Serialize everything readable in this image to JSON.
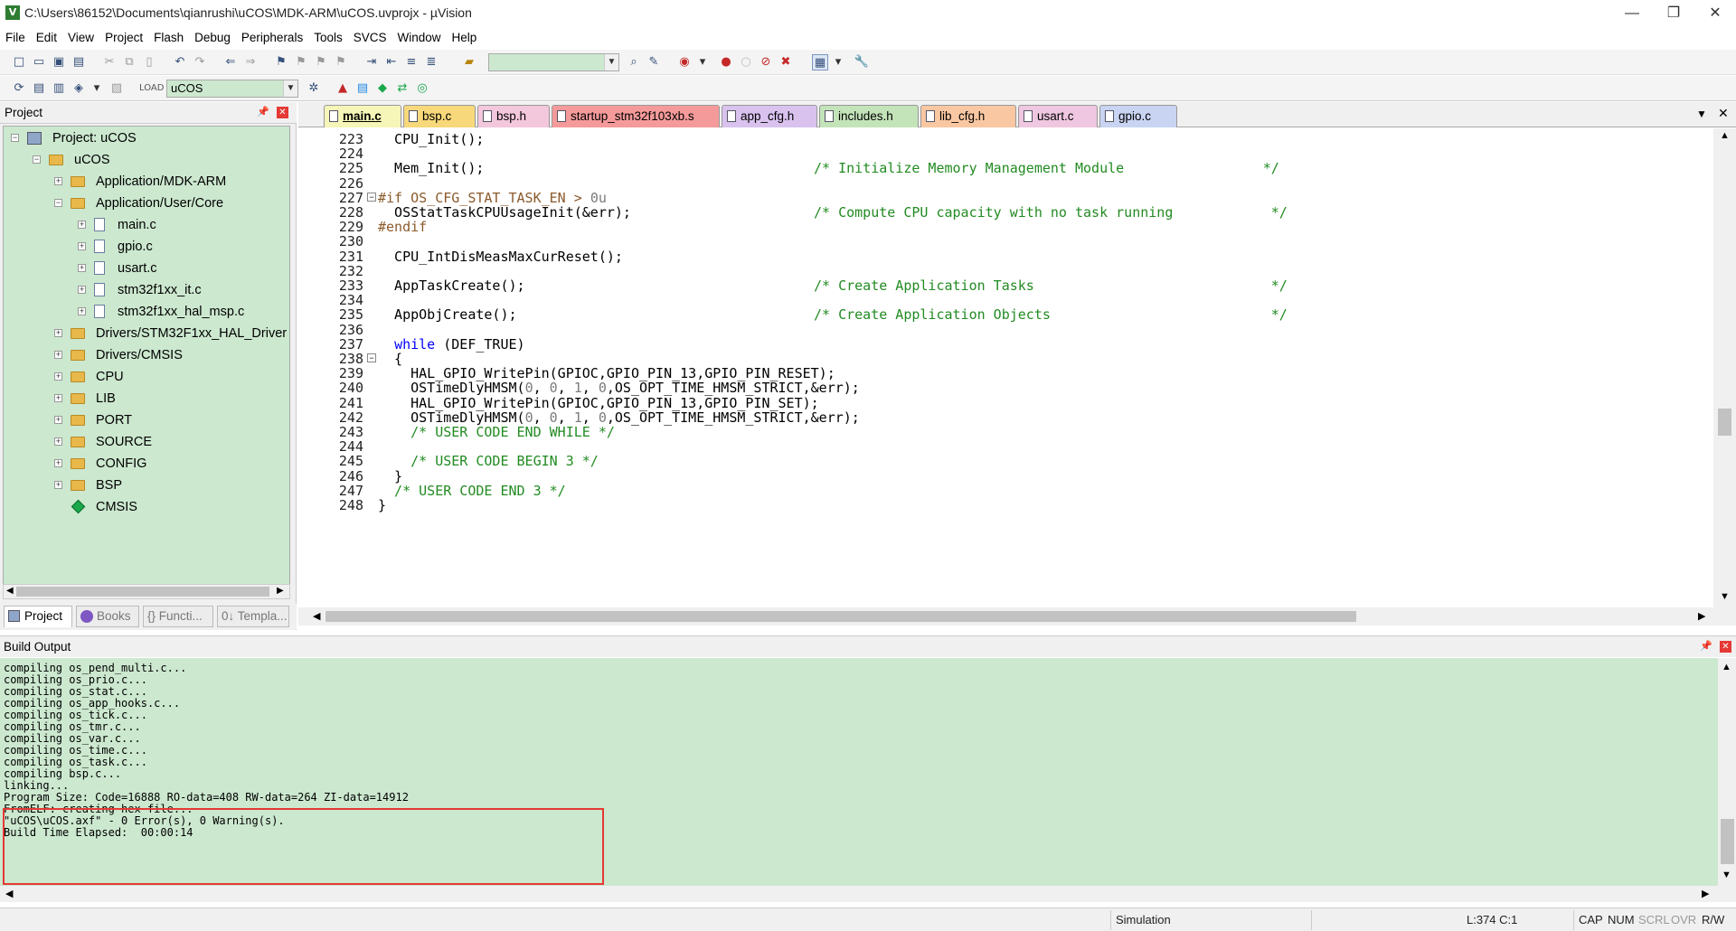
{
  "window": {
    "title": "C:\\Users\\86152\\Documents\\qianrushi\\uCOS\\MDK-ARM\\uCOS.uvprojx - µVision",
    "minimize": "—",
    "restore": "❐",
    "close": "✕"
  },
  "menu": [
    "File",
    "Edit",
    "View",
    "Project",
    "Flash",
    "Debug",
    "Peripherals",
    "Tools",
    "SVCS",
    "Window",
    "Help"
  ],
  "toolbar": {
    "target_name": "uCOS",
    "find_value": ""
  },
  "project_panel": {
    "title": "Project",
    "tree": [
      {
        "label": "Project: uCOS"
      },
      {
        "label": "uCOS"
      },
      {
        "label": "Application/MDK-ARM"
      },
      {
        "label": "Application/User/Core"
      },
      {
        "label": "main.c"
      },
      {
        "label": "gpio.c"
      },
      {
        "label": "usart.c"
      },
      {
        "label": "stm32f1xx_it.c"
      },
      {
        "label": "stm32f1xx_hal_msp.c"
      },
      {
        "label": "Drivers/STM32F1xx_HAL_Driver"
      },
      {
        "label": "Drivers/CMSIS"
      },
      {
        "label": "CPU"
      },
      {
        "label": "LIB"
      },
      {
        "label": "PORT"
      },
      {
        "label": "SOURCE"
      },
      {
        "label": "CONFIG"
      },
      {
        "label": "BSP"
      },
      {
        "label": "CMSIS"
      }
    ],
    "tabs": [
      "Project",
      "Books",
      "{} Functi...",
      "0↓ Templa..."
    ]
  },
  "editor": {
    "tabs": [
      {
        "label": "main.c",
        "color": "#f6f6b8"
      },
      {
        "label": "bsp.c",
        "color": "#f7d87a"
      },
      {
        "label": "bsp.h",
        "color": "#f3c7dc"
      },
      {
        "label": "startup_stm32f103xb.s",
        "color": "#f59a9a"
      },
      {
        "label": "app_cfg.h",
        "color": "#d9c2ee"
      },
      {
        "label": "includes.h",
        "color": "#c3e3b9"
      },
      {
        "label": "lib_cfg.h",
        "color": "#f9c7a2"
      },
      {
        "label": "usart.c",
        "color": "#efc7e0"
      },
      {
        "label": "gpio.c",
        "color": "#c9d4f2"
      }
    ],
    "lines": [
      {
        "n": "223",
        "code": "  CPU_Init();",
        "comment": ""
      },
      {
        "n": "224",
        "code": "",
        "comment": ""
      },
      {
        "n": "225",
        "code": "  Mem_Init();",
        "comment": "/* Initialize Memory Management Module                 */"
      },
      {
        "n": "226",
        "code": "",
        "comment": ""
      },
      {
        "n": "227",
        "code": "#if OS_CFG_STAT_TASK_EN > 0u",
        "comment": ""
      },
      {
        "n": "228",
        "code": "  OSStatTaskCPUUsageInit(&err);",
        "comment": "/* Compute CPU capacity with no task running            */"
      },
      {
        "n": "229",
        "code": "#endif",
        "comment": ""
      },
      {
        "n": "230",
        "code": "",
        "comment": ""
      },
      {
        "n": "231",
        "code": "  CPU_IntDisMeasMaxCurReset();",
        "comment": ""
      },
      {
        "n": "232",
        "code": "",
        "comment": ""
      },
      {
        "n": "233",
        "code": "  AppTaskCreate();",
        "comment": "/* Create Application Tasks                             */"
      },
      {
        "n": "234",
        "code": "",
        "comment": ""
      },
      {
        "n": "235",
        "code": "  AppObjCreate();",
        "comment": "/* Create Application Objects                           */"
      },
      {
        "n": "236",
        "code": "",
        "comment": ""
      },
      {
        "n": "237",
        "code": "  while (DEF_TRUE)",
        "comment": ""
      },
      {
        "n": "238",
        "code": "  {",
        "comment": ""
      },
      {
        "n": "239",
        "code": "    HAL_GPIO_WritePin(GPIOC,GPIO_PIN_13,GPIO_PIN_RESET);",
        "comment": ""
      },
      {
        "n": "240",
        "code": "    OSTimeDlyHMSM(0, 0, 1, 0,OS_OPT_TIME_HMSM_STRICT,&err);",
        "comment": ""
      },
      {
        "n": "241",
        "code": "    HAL_GPIO_WritePin(GPIOC,GPIO_PIN_13,GPIO_PIN_SET);",
        "comment": ""
      },
      {
        "n": "242",
        "code": "    OSTimeDlyHMSM(0, 0, 1, 0,OS_OPT_TIME_HMSM_STRICT,&err);",
        "comment": ""
      },
      {
        "n": "243",
        "code": "    /* USER CODE END WHILE */",
        "comment": ""
      },
      {
        "n": "244",
        "code": "",
        "comment": ""
      },
      {
        "n": "245",
        "code": "    /* USER CODE BEGIN 3 */",
        "comment": ""
      },
      {
        "n": "246",
        "code": "  }",
        "comment": ""
      },
      {
        "n": "247",
        "code": "  /* USER CODE END 3 */",
        "comment": ""
      },
      {
        "n": "248",
        "code": "}",
        "comment": ""
      }
    ]
  },
  "build_output": {
    "title": "Build Output",
    "lines": [
      "compiling os_pend_multi.c...",
      "compiling os_prio.c...",
      "compiling os_stat.c...",
      "compiling os_app_hooks.c...",
      "compiling os_tick.c...",
      "compiling os_tmr.c...",
      "compiling os_var.c...",
      "compiling os_time.c...",
      "compiling os_task.c...",
      "compiling bsp.c...",
      "linking...",
      "Program Size: Code=16888 RO-data=408 RW-data=264 ZI-data=14912",
      "FromELF: creating hex file...",
      "\"uCOS\\uCOS.axf\" - 0 Error(s), 0 Warning(s).",
      "Build Time Elapsed:  00:00:14"
    ],
    "highlight_color": "#e53935"
  },
  "statusbar": {
    "mode": "Simulation",
    "position": "L:374 C:1",
    "caps": "CAP",
    "num": "NUM",
    "scrl": "SCRL",
    "ovr": "OVR",
    "rw": "R/W"
  },
  "colors": {
    "pane_green": "#cce8cf",
    "comment_green": "#228b22",
    "keyword_blue": "#0000ff"
  }
}
